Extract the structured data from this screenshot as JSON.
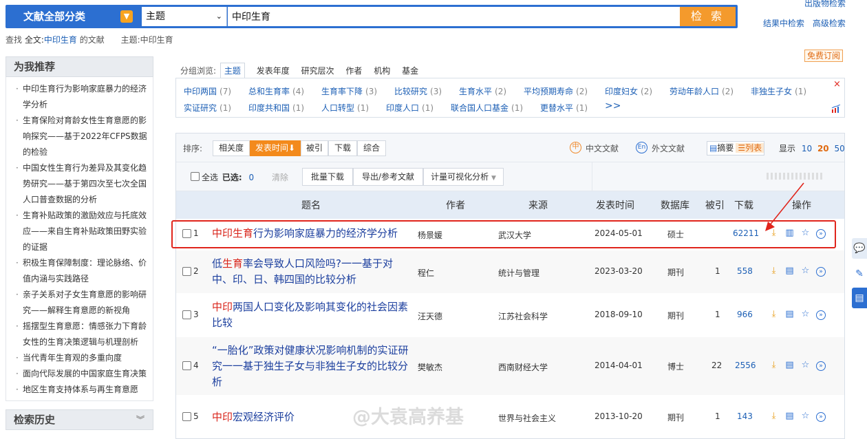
{
  "search": {
    "category": "文献全部分类",
    "field": "主题",
    "query": "中印生育",
    "button": "检 索"
  },
  "top_links": {
    "publication_search": "出版物检索",
    "result_search": "结果中检索",
    "advanced_search": "高级检索",
    "free_subscribe": "免费订阅"
  },
  "query_summary": {
    "prefix": "查找",
    "fulltext_label": "全文:",
    "fulltext_term": "中印生育",
    "fulltext_suffix": "的文献",
    "subject": "主题:中印生育"
  },
  "recommend": {
    "title": "为我推荐",
    "items": [
      "中印生育行为影响家庭暴力的经济学分析",
      "生育保险对育龄女性生育意愿的影响探究——基于2022年CFPS数据的检验",
      "中国女性生育行为差异及其变化趋势研究——基于第四次至七次全国人口普查数据的分析",
      "生育补贴政策的激励效应与托底效应——来自生育补贴政策田野实验的证据",
      "积极生育保障制度：理论脉络、价值内涵与实践路径",
      "亲子关系对子女生育意愿的影响研究——解释生育意愿的新视角",
      "摇摆型生育意愿：情感张力下育龄女性的生育决策逻辑与机理剖析",
      "当代青年生育观的多重向度",
      "面向代际发展的中国家庭生育决策",
      "地区生育支持体系与再生育意愿"
    ]
  },
  "history": {
    "title": "检索历史"
  },
  "group_browse": {
    "label": "分组浏览:",
    "tabs": [
      "主题",
      "发表年度",
      "研究层次",
      "作者",
      "机构",
      "基金"
    ]
  },
  "facets": [
    {
      "name": "中印两国",
      "count": "(7)"
    },
    {
      "name": "总和生育率",
      "count": "(4)"
    },
    {
      "name": "生育率下降",
      "count": "(3)"
    },
    {
      "name": "比较研究",
      "count": "(3)"
    },
    {
      "name": "生育水平",
      "count": "(2)"
    },
    {
      "name": "平均预期寿命",
      "count": "(2)"
    },
    {
      "name": "印度妇女",
      "count": "(2)"
    },
    {
      "name": "劳动年龄人口",
      "count": "(2)"
    },
    {
      "name": "非独生子女",
      "count": "(1)"
    },
    {
      "name": "实证研究",
      "count": "(1)"
    },
    {
      "name": "印度共和国",
      "count": "(1)"
    },
    {
      "name": "人口转型",
      "count": "(1)"
    },
    {
      "name": "印度人口",
      "count": "(1)"
    },
    {
      "name": "联合国人口基金",
      "count": "(1)"
    },
    {
      "name": "更替水平",
      "count": "(1)"
    }
  ],
  "facet_more": ">>",
  "sort": {
    "label": "排序:",
    "options": [
      "相关度",
      "发表时间",
      "被引",
      "下载",
      "综合"
    ],
    "active_arrow": "⬇",
    "cn_docs": "中文文献",
    "foreign_docs": "外文文献",
    "view_summary": "摘要",
    "view_list": "列表",
    "display_label": "显示",
    "page_sizes": [
      "10",
      "20",
      "50"
    ]
  },
  "actions": {
    "select_all": "全选",
    "selected_label": "已选:",
    "selected_count": "0",
    "clear": "清除",
    "batch_download": "批量下载",
    "export": "导出/参考文献",
    "visualize": "计量可视化分析"
  },
  "table": {
    "headers": [
      "题名",
      "作者",
      "来源",
      "发表时间",
      "数据库",
      "被引",
      "下载",
      "操作"
    ],
    "rows": [
      {
        "num": "1",
        "title_hl": "中印生育",
        "title_rest": "行为影响家庭暴力的经济学分析",
        "author": "杨景媛",
        "source": "武汉大学",
        "date": "2024-05-01",
        "db": "硕士",
        "cited": "",
        "downloads": "62211"
      },
      {
        "num": "2",
        "title_pre": "低",
        "title_hl": "生育",
        "title_rest": "率会导致人口风险吗?一一基于对中、印、日、韩四国的比较分析",
        "author": "程仁",
        "source": "统计与管理",
        "date": "2023-03-20",
        "db": "期刊",
        "cited": "1",
        "downloads": "558"
      },
      {
        "num": "3",
        "title_hl": "中印",
        "title_rest": "两国人口变化及影响其变化的社会因素比较",
        "author": "汪天德",
        "source": "江苏社会科学",
        "date": "2018-09-10",
        "db": "期刊",
        "cited": "1",
        "downloads": "966"
      },
      {
        "num": "4",
        "title_hl": "",
        "title_rest": "“一胎化”政策对健康状况影响机制的实证研究一一基于独生子女与非独生子女的比较分析",
        "author": "樊敏杰",
        "source": "西南财经大学",
        "date": "2014-04-01",
        "db": "博士",
        "cited": "22",
        "downloads": "2556"
      },
      {
        "num": "5",
        "title_hl": "中印",
        "title_rest": "宏观经济评价",
        "author": "",
        "source": "世界与社会主义",
        "date": "2013-10-20",
        "db": "期刊",
        "cited": "1",
        "downloads": "143"
      }
    ]
  },
  "watermark": "@大袁高养基",
  "colors": {
    "brand_blue": "#2c6fd1",
    "accent_orange": "#f38a1c",
    "highlight_red": "#e0241b"
  }
}
